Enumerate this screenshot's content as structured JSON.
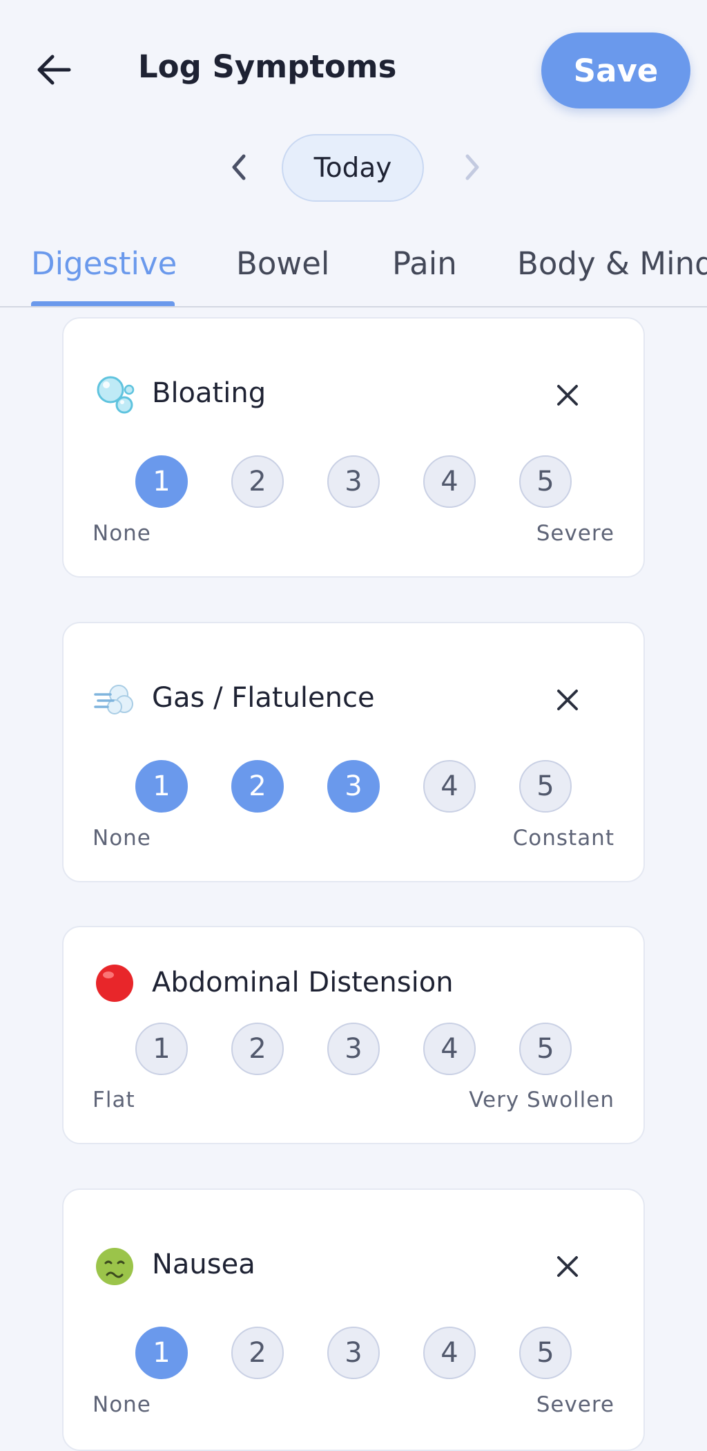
{
  "header": {
    "title": "Log Symptoms",
    "save_label": "Save"
  },
  "date_nav": {
    "current": "Today"
  },
  "tabs": [
    {
      "label": "Digestive",
      "active": true
    },
    {
      "label": "Bowel",
      "active": false
    },
    {
      "label": "Pain",
      "active": false
    },
    {
      "label": "Body & Mind",
      "active": false
    }
  ],
  "symptoms": [
    {
      "name": "Bloating",
      "icon": "bubbles-icon",
      "severity": 1,
      "scale": [
        "1",
        "2",
        "3",
        "4",
        "5"
      ],
      "min_label": "None",
      "max_label": "Severe",
      "removable": true
    },
    {
      "name": "Gas / Flatulence",
      "icon": "dashing-away-icon",
      "severity": 3,
      "scale": [
        "1",
        "2",
        "3",
        "4",
        "5"
      ],
      "min_label": "None",
      "max_label": "Constant",
      "removable": true
    },
    {
      "name": "Abdominal Distension",
      "icon": "red-circle-icon",
      "severity": 0,
      "scale": [
        "1",
        "2",
        "3",
        "4",
        "5"
      ],
      "min_label": "Flat",
      "max_label": "Very Swollen",
      "removable": false
    },
    {
      "name": "Nausea",
      "icon": "nauseated-face-icon",
      "severity": 1,
      "scale": [
        "1",
        "2",
        "3",
        "4",
        "5"
      ],
      "min_label": "None",
      "max_label": "Severe",
      "removable": true
    }
  ],
  "colors": {
    "accent": "#6A99EC",
    "background": "#F3F5FB",
    "card": "#FFFFFF",
    "text": "#1E2233",
    "muted": "#5E6477"
  }
}
